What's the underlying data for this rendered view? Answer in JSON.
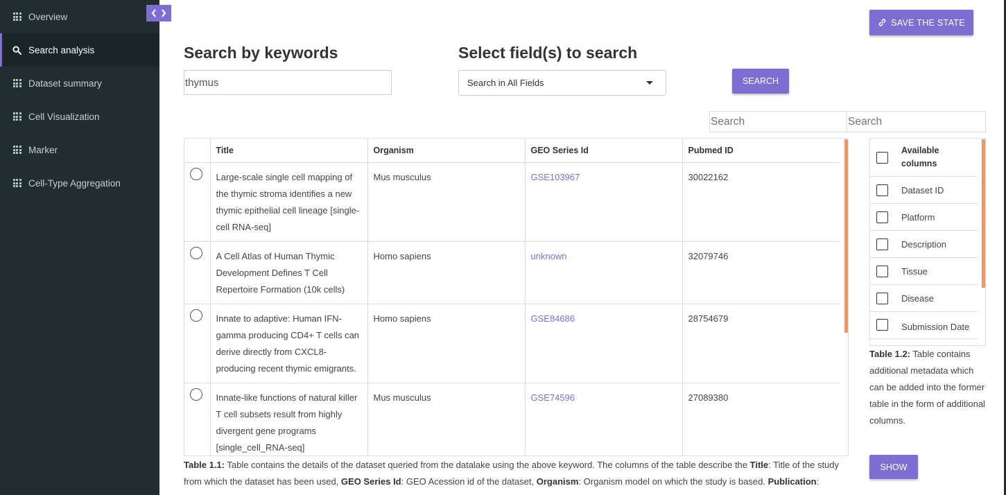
{
  "sidebar": {
    "items": [
      {
        "label": "Overview",
        "icon": "grid-icon"
      },
      {
        "label": "Search analysis",
        "icon": "search-icon"
      },
      {
        "label": "Dataset summary",
        "icon": "grid-icon"
      },
      {
        "label": "Cell Visualization",
        "icon": "grid-icon"
      },
      {
        "label": "Marker",
        "icon": "grid-icon"
      },
      {
        "label": "Cell-Type Aggregation",
        "icon": "grid-icon"
      }
    ],
    "active_index": 1
  },
  "toolbar": {
    "save_label": "SAVE THE STATE",
    "save_icon": "link-icon"
  },
  "search": {
    "keywords_title": "Search by keywords",
    "keyword_value": "thymus",
    "fields_title": "Select field(s) to search",
    "field_selected": "Search in All Fields",
    "search_label": "SEARCH"
  },
  "filters": {
    "placeholder_1": "Search",
    "placeholder_2": "Search"
  },
  "main_table": {
    "headers": [
      "Title",
      "Organism",
      "GEO Series Id",
      "Pubmed ID"
    ],
    "rows": [
      {
        "title": "Large-scale single cell mapping of the thymic stroma identifies a new thymic epithelial cell lineage [single-cell RNA-seq]",
        "organism": "Mus musculus",
        "geo": "GSE103967",
        "pubmed": "30022162"
      },
      {
        "title": "A Cell Atlas of Human Thymic Development Defines T Cell Repertoire Formation (10k cells)",
        "organism": "Homo sapiens",
        "geo": "unknown",
        "pubmed": "32079746"
      },
      {
        "title": "Innate to adaptive: Human IFN-gamma producing CD4+ T cells can derive directly from CXCL8-producing recent thymic emigrants.",
        "organism": "Homo sapiens",
        "geo": "GSE84686",
        "pubmed": "28754679"
      },
      {
        "title": "Innate-like functions of natural killer T cell subsets result from highly divergent gene programs [single_cell_RNA-seq]",
        "organism": "Mus musculus",
        "geo": "GSE74596",
        "pubmed": "27089380"
      }
    ]
  },
  "side_table": {
    "header": "Available columns",
    "items": [
      "Dataset ID",
      "Platform",
      "Description",
      "Tissue",
      "Disease",
      "Submission Date"
    ]
  },
  "captions": {
    "table_1_2_label": "Table 1.2:",
    "table_1_2_text": " Table contains additional metadata which can be added into the former table in the form of additional columns.",
    "table_1_1_label": "Table 1.1:",
    "table_1_1_text_a": " Table contains the details of the dataset queried from the datalake using the above keyword. The columns of the table describe the ",
    "title_bold": "Title",
    "table_1_1_text_b": ": Title of the study from which the dataset has been used, ",
    "geo_bold": "GEO Series Id",
    "table_1_1_text_c": ": GEO Acession id of the dataset, ",
    "organism_bold": "Organism",
    "table_1_1_text_d": ": Organism model on which the study is based. ",
    "publication_bold": "Publication",
    "table_1_1_text_e": ":"
  },
  "show_label": "SHOW",
  "colors": {
    "accent": "#7e6ed1",
    "sidebar_bg": "#222d32",
    "scrollbar": "#f0956a"
  }
}
